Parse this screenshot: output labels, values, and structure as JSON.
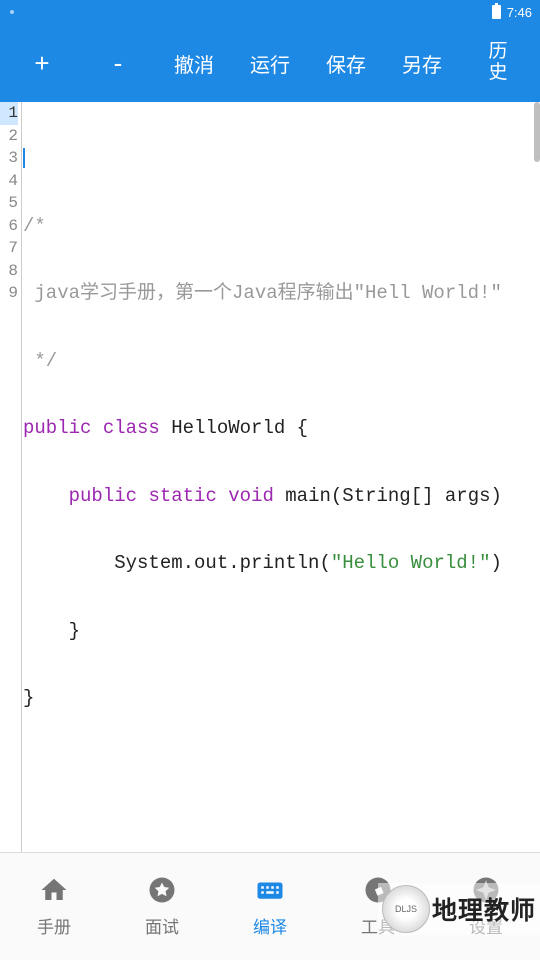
{
  "status": {
    "time": "7:46"
  },
  "toolbar": {
    "zoom_in": "+",
    "zoom_out": "-",
    "undo": "撤消",
    "run": "运行",
    "save": "保存",
    "save_as": "另存",
    "history": "历史"
  },
  "editor": {
    "line_numbers": [
      "1",
      "2",
      "3",
      "4",
      "5",
      "6",
      "7",
      "8",
      "9"
    ],
    "code": {
      "l1": "",
      "l2": "/*",
      "l3_pre": " java学习手册，第一个Java程序输出\"Hell World!\"",
      "l4": " */",
      "l5_public": "public",
      "l5_class": "class",
      "l5_name": " HelloWorld {",
      "l6_public": "public",
      "l6_static": "static",
      "l6_void": "void",
      "l6_main": " main(String[] args)",
      "l7_sys": "        System.out.println(",
      "l7_str": "\"Hello World!\"",
      "l8": "    }",
      "l9": "}"
    }
  },
  "bottom_nav": {
    "manual": "手册",
    "interview": "面试",
    "compile": "编译",
    "tools": "工具",
    "settings": "设置"
  },
  "watermark": {
    "text": "地理教师"
  }
}
